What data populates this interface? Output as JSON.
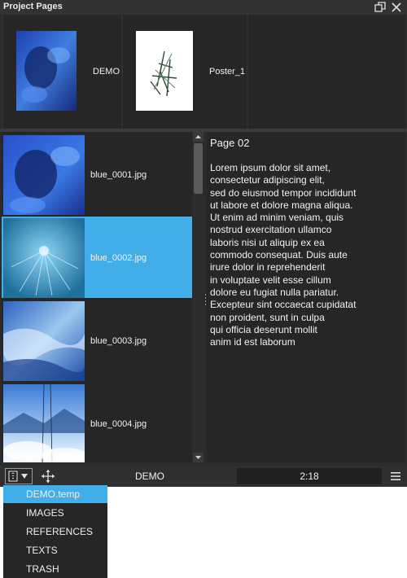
{
  "window": {
    "title": "Project Pages"
  },
  "project_pages": [
    {
      "label": "DEMO"
    },
    {
      "label": "Poster_1"
    }
  ],
  "images": [
    {
      "name": "blue_0001.jpg",
      "selected": false
    },
    {
      "name": "blue_0002.jpg",
      "selected": true
    },
    {
      "name": "blue_0003.jpg",
      "selected": false
    },
    {
      "name": "blue_0004.jpg",
      "selected": false
    }
  ],
  "text_pane": {
    "title": "Page 02",
    "body": "Lorem ipsum dolor sit amet,\nconsectetur adipiscing elit,\nsed do eiusmod tempor incididunt\nut labore et dolore magna aliqua.\nUt enim ad minim veniam, quis\nnostrud exercitation ullamco\nlaboris nisi ut aliquip ex ea\ncommodo consequat. Duis aute\nirure dolor in reprehenderit\nin voluptate velit esse cillum\ndolore eu fugiat nulla pariatur.\nExcepteur sint occaecat cupidatat\nnon proident, sunt in culpa\nqui officia deserunt mollit\nanim id est laborum"
  },
  "toolbar": {
    "document": "DEMO",
    "time": "2:18"
  },
  "dropdown": {
    "items": [
      "DEMO.temp",
      "IMAGES",
      "REFERENCES",
      "TEXTS",
      "TRASH"
    ],
    "selected": "DEMO.temp"
  },
  "colors": {
    "accent": "#42aee9",
    "panel": "#2b2b2b",
    "cell": "#262626"
  },
  "icons": [
    "restore-window-icon",
    "close-icon",
    "view-dropdown-icon",
    "move-icon",
    "hamburger-menu-icon",
    "scroll-up-arrow-icon",
    "scroll-down-arrow-icon"
  ]
}
